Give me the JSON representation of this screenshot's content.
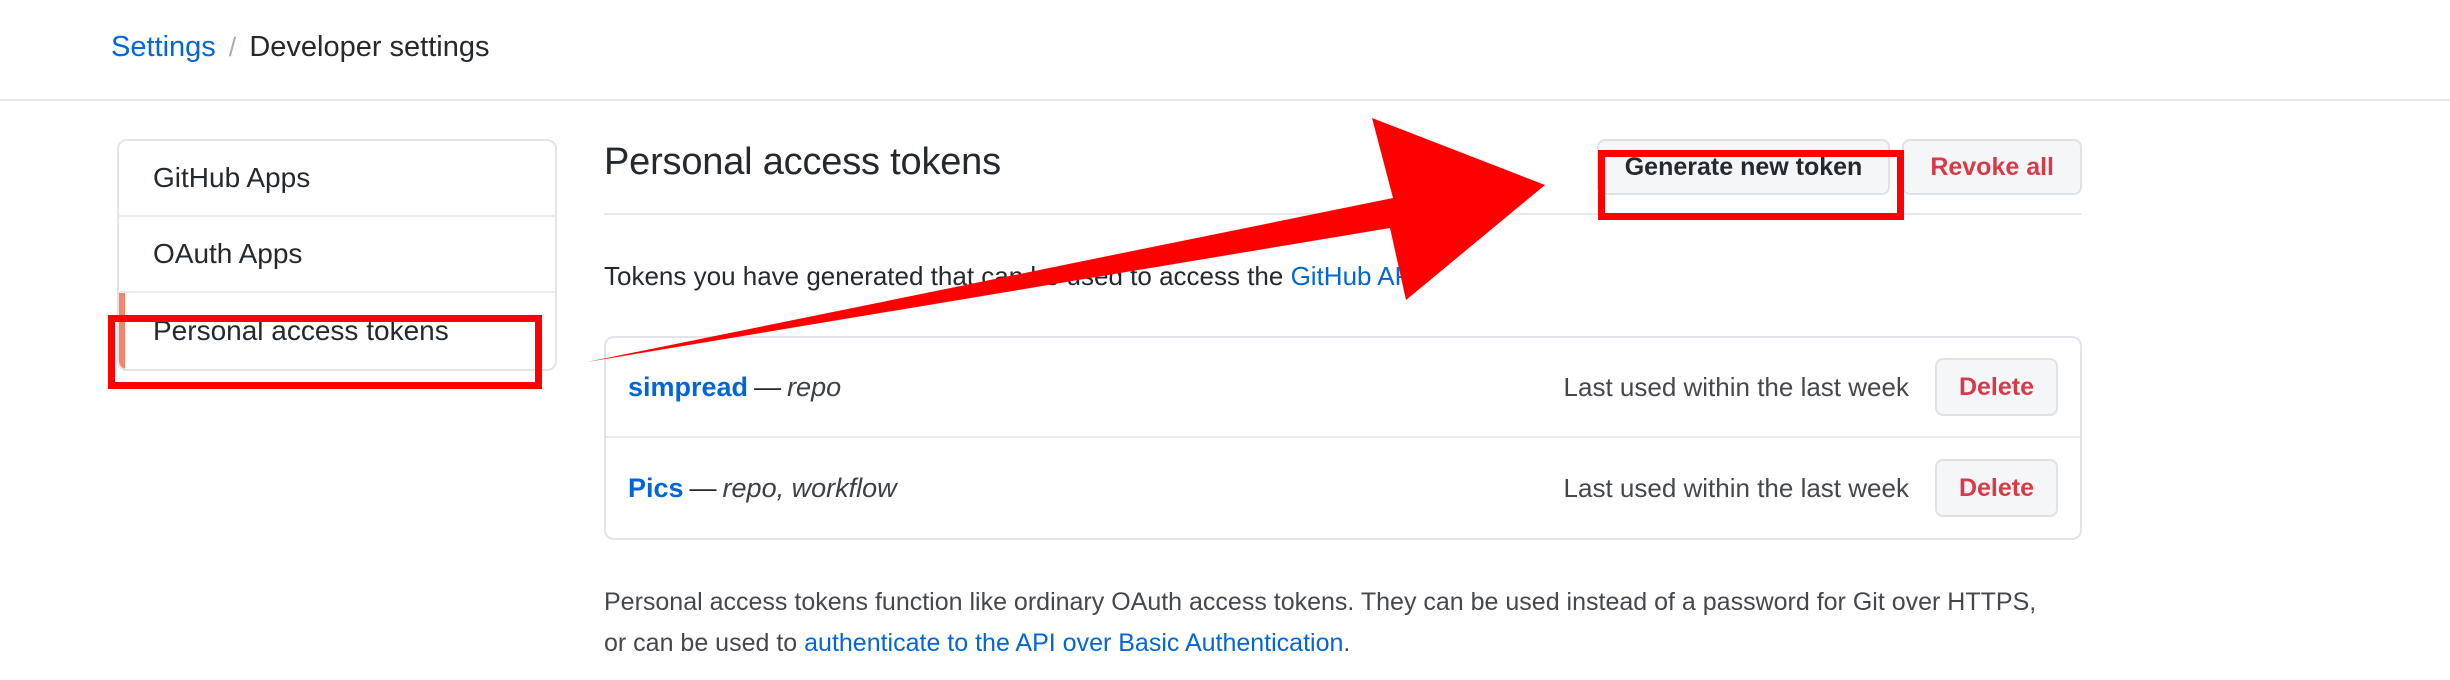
{
  "header": {
    "breadcrumb": {
      "root_label": "Settings",
      "separator": "/",
      "current_label": "Developer settings"
    }
  },
  "sidebar": {
    "items": [
      {
        "label": "GitHub Apps",
        "selected": false
      },
      {
        "label": "OAuth Apps",
        "selected": false
      },
      {
        "label": "Personal access tokens",
        "selected": true
      }
    ]
  },
  "main": {
    "title": "Personal access tokens",
    "actions": {
      "generate_label": "Generate new token",
      "revoke_label": "Revoke all"
    },
    "description": {
      "prefix": "Tokens you have generated that can be used to access the ",
      "link_label": "GitHub API",
      "suffix": "."
    },
    "tokens": [
      {
        "name": "simpread",
        "dash": "—",
        "scopes": "repo",
        "last_used": "Last used within the last week",
        "delete_label": "Delete"
      },
      {
        "name": "Pics",
        "dash": "—",
        "scopes": "repo, workflow",
        "last_used": "Last used within the last week",
        "delete_label": "Delete"
      }
    ],
    "footnote": {
      "prefix": "Personal access tokens function like ordinary OAuth access tokens. They can be used instead of a password for Git over HTTPS, or can be used to ",
      "link_label": "authenticate to the API over Basic Authentication",
      "suffix": "."
    }
  },
  "annotations": {
    "color": "#ff0000",
    "arrow": {
      "from_label": "personal-access-tokens-list",
      "to_label": "generate-new-token-button"
    },
    "boxes": [
      {
        "target": "sidebar-item-personal-access-tokens"
      },
      {
        "target": "generate-new-token-button"
      }
    ]
  }
}
